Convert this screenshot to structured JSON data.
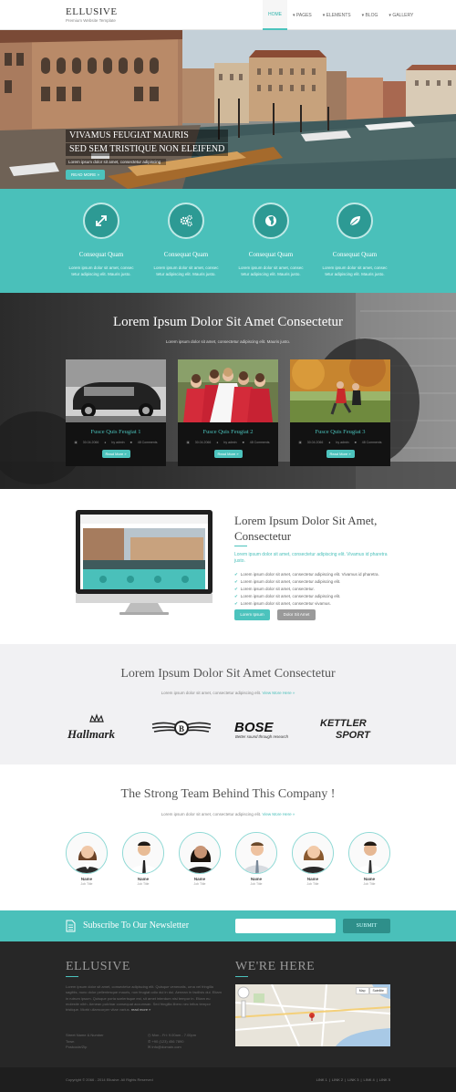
{
  "header": {
    "logo_title": "ELLUSIVE",
    "logo_subtitle": "Premium Website Template",
    "nav": [
      "HOME",
      "▾ PAGES",
      "▾ ELEMENTS",
      "▾ BLOG",
      "▾ GALLERY"
    ]
  },
  "hero": {
    "title_line1": "VIVAMUS FEUGIAT MAURIS",
    "title_line2": "SED SEM TRISTIQUE NON ELEIFEND",
    "text": "Lorem ipsum dolor sit amet, consectetur adipiscing",
    "button": "READ MORE »"
  },
  "features": [
    {
      "icon": "expand-arrows-icon",
      "title": "Consequat Quam",
      "text": "Lorem ipsum dolor sit amet, consec tetur adipiscing elit. Mauris justo."
    },
    {
      "icon": "gears-icon",
      "title": "Consequat Quam",
      "text": "Lorem ipsum dolor sit amet, consec tetur adipiscing elit. Mauris justo."
    },
    {
      "icon": "globe-icon",
      "title": "Consequat Quam",
      "text": "Lorem ipsum dolor sit amet, consec tetur adipiscing elit. Mauris justo."
    },
    {
      "icon": "leaf-icon",
      "title": "Consequat Quam",
      "text": "Lorem ipsum dolor sit amet, consec tetur adipiscing elit. Mauris justo."
    }
  ],
  "gallery": {
    "title": "Lorem Ipsum Dolor Sit Amet Consectetur",
    "subtitle": "Lorem ipsum dolor sit amet, consectetur adipiscing elit. Mauris justo.",
    "cards": [
      {
        "title": "Fusce Quis Feugiat 1",
        "date": "30.04.2066",
        "author": "by admin",
        "comments": "48 Comments",
        "button": "Read More »"
      },
      {
        "title": "Fusce Quis Feugiat 2",
        "date": "30.04.2066",
        "author": "by admin",
        "comments": "48 Comments",
        "button": "Read More »"
      },
      {
        "title": "Fusce Quis Feugiat 3",
        "date": "30.04.2066",
        "author": "by admin",
        "comments": "48 Comments",
        "button": "Read More »"
      }
    ]
  },
  "about": {
    "title": "Lorem Ipsum Dolor Sit Amet, Consectetur",
    "lead": "Lorem ipsum dolor sit amet, consectetur adipiscing elit. Vivamus id pharetra justo.",
    "list": [
      "Lorem ipsum dolor sit amet, consectetur adipiscing elit. Vivamus id pharetra.",
      "Lorem ipsum dolor sit amet, consectetur adipiscing elit.",
      "Lorem ipsum dolor sit amet, consectetur.",
      "Lorem ipsum dolor sit amet, consectetur adipiscing elit.",
      "Lorem ipsum dolor sit amet, consectetur vivamus."
    ],
    "button_primary": "Lorem Ipsum",
    "button_secondary": "Dolor Sit Amet"
  },
  "clients": {
    "title": "Lorem Ipsum Dolor Sit Amet Consectetur",
    "subtitle": "Lorem ipsum dolor sit amet, consectetur adipiscing elit.",
    "link": "View More Here »",
    "logos": {
      "hallmark": "Hallmark",
      "bentley_letter": "B",
      "bose": "BOSE",
      "bose_tagline": "Better sound through research",
      "kettler_line1": "KETTLER",
      "kettler_line2": "SPORT"
    }
  },
  "team": {
    "title": "The Strong Team Behind This Company !",
    "subtitle": "Lorem ipsum dolor sit amet, consectetur adipiscing elit.",
    "link": "View More Here »",
    "members": [
      {
        "name": "Name",
        "role": "Job Title"
      },
      {
        "name": "Name",
        "role": "Job Title"
      },
      {
        "name": "Name",
        "role": "Job Title"
      },
      {
        "name": "Name",
        "role": "Job Title"
      },
      {
        "name": "Name",
        "role": "Job Title"
      },
      {
        "name": "Name",
        "role": "Job Title"
      }
    ]
  },
  "newsletter": {
    "title": "Subscribe To Our Newsletter",
    "placeholder": "",
    "button": "SUBMIT"
  },
  "footer": {
    "about_title": "ELLUSIVE",
    "about_text": "Lorem ipsum dolor sit amet, consectetur adipiscing elit. Quisque venenatis, urna vel fringilla sagittis, nunc dolor pellentesque mauris, non feugiat odio dui in dui. Aenean in facilisis dui. Etiam in rutrum ipsum. Quisque porta scelerisque est, sit amet interdum nisi tempor in. Etiam eu molestie nibh. Aenean pulvinar consequat accumsan. Sed fringilla libero nec tellus tempor tristique. Morbi ullamcorper vitae varius.",
    "read_more": "read more »",
    "address": [
      "Street Name & Number",
      "Town",
      "Postcode/Zip"
    ],
    "contact": [
      "Mon - Fri: 9.00am - 7.00pm",
      "+90 (123) 456 7890",
      "info@domain.com"
    ],
    "map_title": "WE'RE HERE",
    "map_buttons": [
      "Map",
      "Satellite"
    ],
    "copyright": "Copyright © 2066 - 2014 Ellusive. All Rights Reserved",
    "links": [
      "LINK 1",
      "LINK 2",
      "LINK 3",
      "LINK 4",
      "LINK 5"
    ]
  },
  "colors": {
    "accent": "#4ac0ba",
    "dark": "#272727",
    "light_grey": "#f1f1f3"
  }
}
